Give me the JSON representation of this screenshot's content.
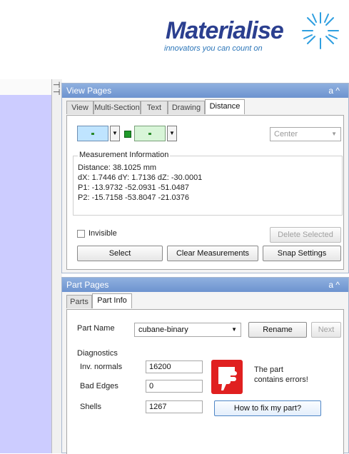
{
  "logo": {
    "name": "Materialise",
    "tagline": "innovators you can count on"
  },
  "view_pages": {
    "title": "View Pages",
    "controls": "a ^",
    "tabs": [
      "View",
      "Multi-Section",
      "Text",
      "Drawing",
      "Distance"
    ],
    "active_tab": "Distance",
    "alignment": "Center",
    "measurement_label": "Measurement Information",
    "distance": "Distance: 38.1025 mm",
    "deltas": "dX: 1.7446 dY: 1.7136 dZ: -30.0001",
    "p1": "P1: -13.9732 -52.0931 -51.0487",
    "p2": "P2: -15.7158 -53.8047 -21.0376",
    "invisible_label": "Invisible",
    "delete_selected": "Delete Selected",
    "select": "Select",
    "clear_measurements": "Clear Measurements",
    "snap_settings": "Snap Settings",
    "colors": {
      "color_a": "#bfe4ff",
      "color_b": "#d8f5d8",
      "marker": "#1f9a2a"
    }
  },
  "part_pages": {
    "title": "Part Pages",
    "controls": "a ^",
    "tabs": [
      "Parts",
      "Part Info"
    ],
    "active_tab": "Part Info",
    "part_name_label": "Part Name",
    "part_name_value": "cubane-binary",
    "rename": "Rename",
    "next": "Next",
    "diagnostics_label": "Diagnostics",
    "inv_normals_label": "Inv. normals",
    "inv_normals_value": "16200",
    "bad_edges_label": "Bad Edges",
    "bad_edges_value": "0",
    "shells_label": "Shells",
    "shells_value": "1267",
    "error_message_line1": "The part",
    "error_message_line2": "contains errors!",
    "fix_button": "How to fix my part?",
    "colors": {
      "error_badge": "#e02020"
    }
  }
}
